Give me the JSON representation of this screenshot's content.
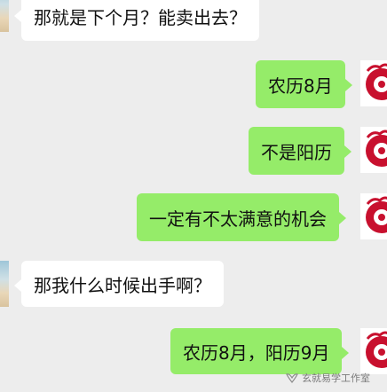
{
  "messages": [
    {
      "side": "in",
      "text": "那就是下个月？能卖出去？"
    },
    {
      "side": "out",
      "text": "农历8月"
    },
    {
      "side": "out",
      "text": "不是阳历"
    },
    {
      "side": "out",
      "text": "一定有不太满意的机会"
    },
    {
      "side": "in",
      "text": "那我什么时候出手啊？"
    },
    {
      "side": "out",
      "text": "农历8月，阳历9月"
    }
  ],
  "watermark": {
    "text": "玄就易学工作室",
    "icon": "wechat-channel-icon"
  },
  "colors": {
    "background": "#ededed",
    "outgoing_bubble": "#95ec69",
    "incoming_bubble": "#ffffff",
    "avatar_red": "#c8102e"
  }
}
